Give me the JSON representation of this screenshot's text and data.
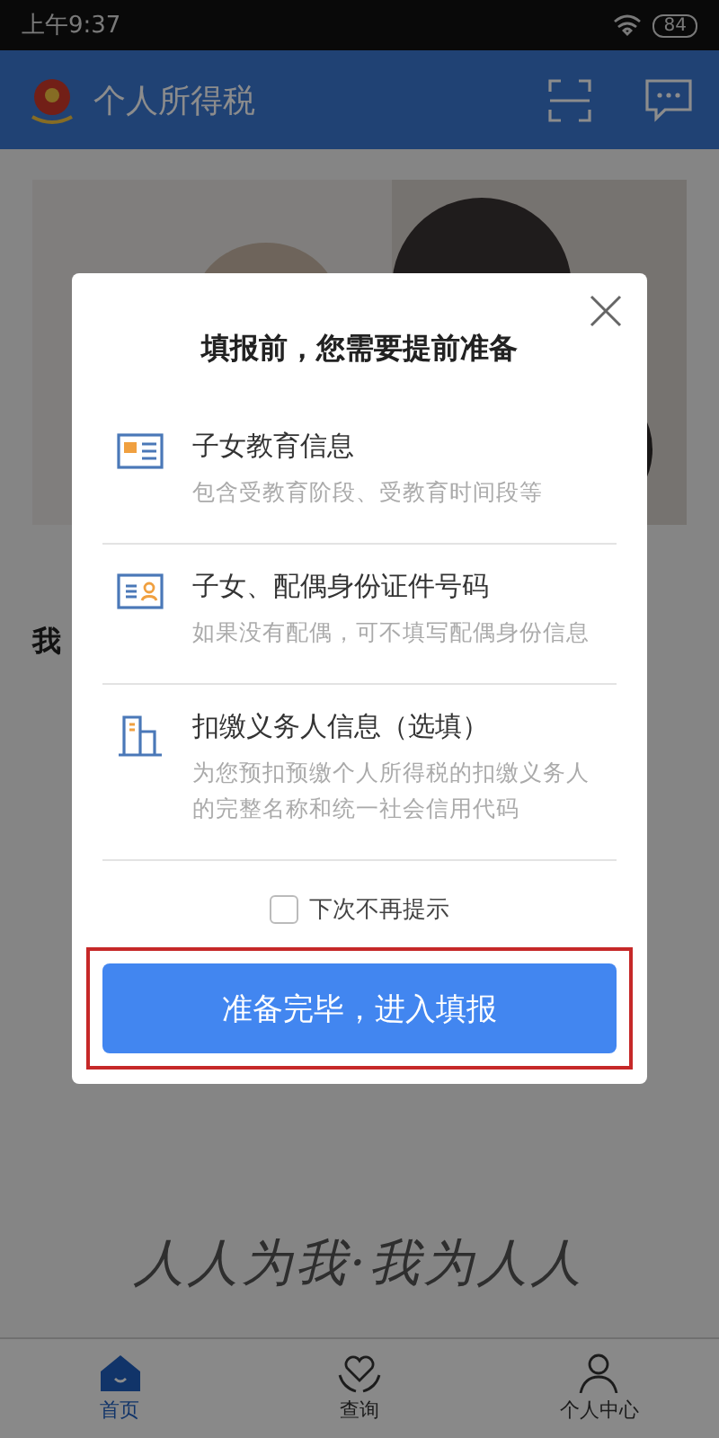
{
  "status_bar": {
    "time": "上午9:37",
    "battery": "84"
  },
  "header": {
    "title": "个人所得税"
  },
  "background": {
    "section_title": "我",
    "slogan": "人人为我·我为人人"
  },
  "bottom_nav": [
    {
      "label": "首页",
      "selected": true,
      "kind": "home"
    },
    {
      "label": "查询",
      "selected": false,
      "kind": "query"
    },
    {
      "label": "个人中心",
      "selected": false,
      "kind": "profile"
    }
  ],
  "dialog": {
    "title": "填报前，您需要提前准备",
    "items": [
      {
        "kind": "education",
        "title": "子女教育信息",
        "description": "包含受教育阶段、受教育时间段等"
      },
      {
        "kind": "id",
        "title": "子女、配偶身份证件号码",
        "description": "如果没有配偶，可不填写配偶身份信息"
      },
      {
        "kind": "employer",
        "title": "扣缴义务人信息（选填）",
        "description": "为您预扣预缴个人所得税的扣缴义务人的完整名称和统一社会信用代码"
      }
    ],
    "dont_remind": {
      "label": "下次不再提示",
      "checked": false
    },
    "confirm_button": "准备完毕，进入填报",
    "highlighted": true
  }
}
